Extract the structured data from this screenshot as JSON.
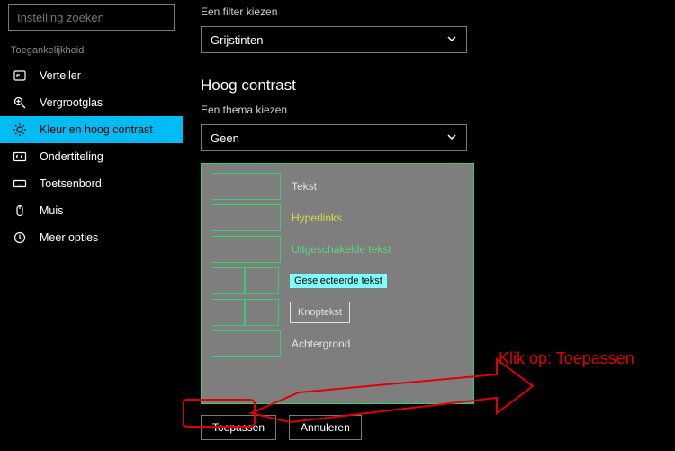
{
  "search": {
    "placeholder": "Instelling zoeken"
  },
  "sidebar": {
    "section_label": "Toegankelijkheid",
    "items": [
      {
        "label": "Verteller"
      },
      {
        "label": "Vergrootglas"
      },
      {
        "label": "Kleur en hoog contrast"
      },
      {
        "label": "Ondertiteling"
      },
      {
        "label": "Toetsenbord"
      },
      {
        "label": "Muis"
      },
      {
        "label": "Meer opties"
      }
    ]
  },
  "filter": {
    "label": "Een filter kiezen",
    "value": "Grijstinten"
  },
  "high_contrast": {
    "heading": "Hoog contrast",
    "theme_label": "Een thema kiezen",
    "theme_value": "Geen"
  },
  "preview": {
    "text": "Tekst",
    "hyperlinks": "Hyperlinks",
    "disabled": "Uitgeschakelde tekst",
    "selected": "Geselecteerde tekst",
    "button": "Knoptekst",
    "background": "Achtergrond"
  },
  "buttons": {
    "apply": "Toepassen",
    "cancel": "Annuleren"
  },
  "annotation": {
    "text": "Klik op:  Toepassen"
  }
}
